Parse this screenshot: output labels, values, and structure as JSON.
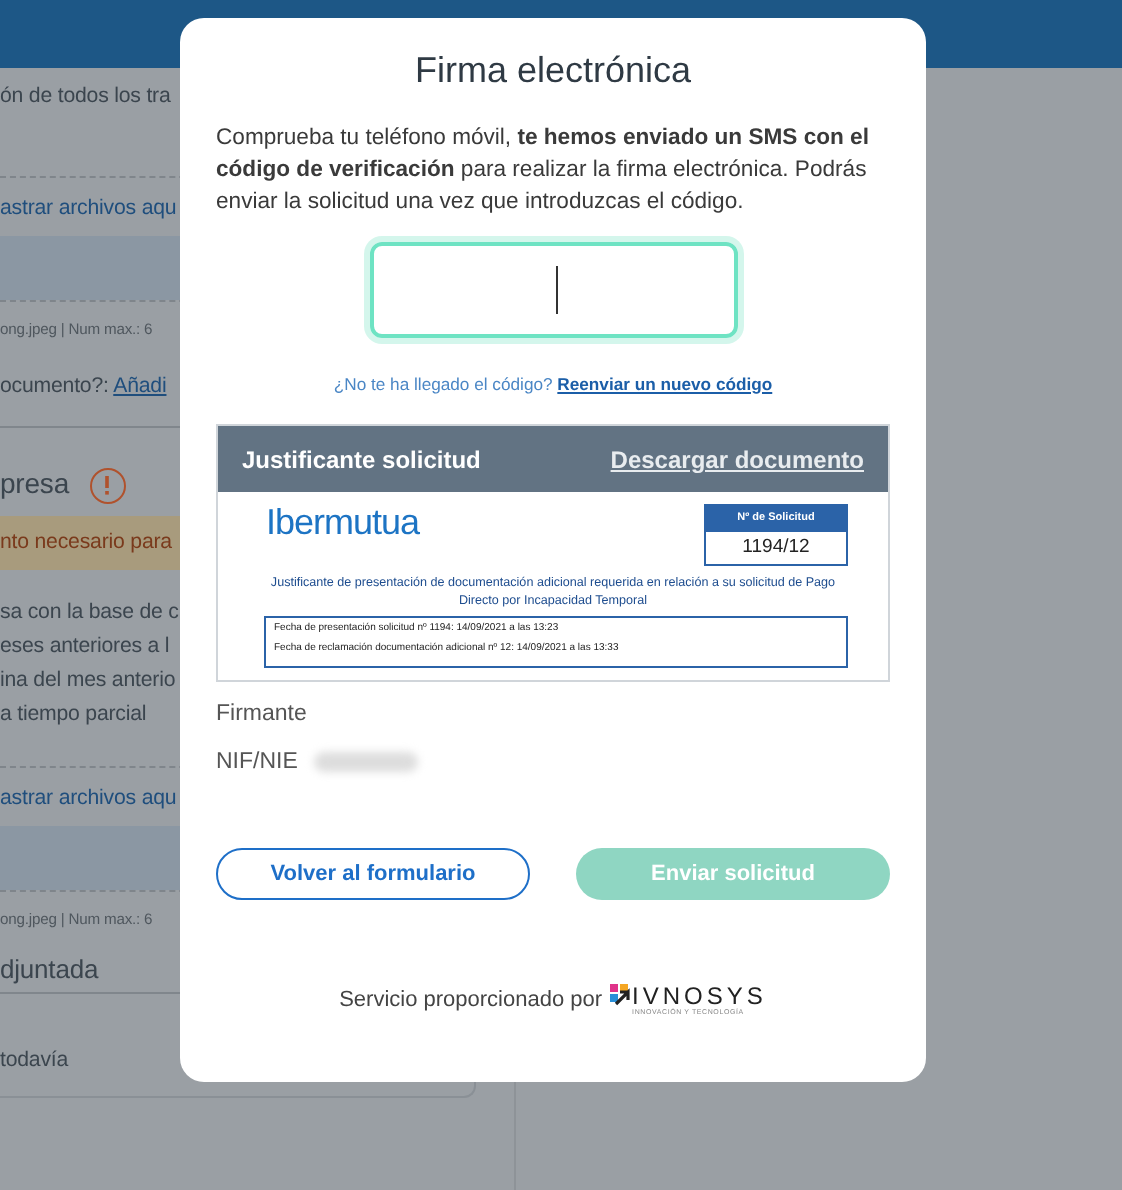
{
  "background": {
    "rows": [
      {
        "kind": "text",
        "text": "ón de todos los tra"
      },
      {
        "kind": "dropzone",
        "text": "astrar archivos aqu"
      },
      {
        "kind": "hint",
        "text": "ong.jpeg | Num max.: 6"
      },
      {
        "kind": "linkline",
        "text": "ocumento?: ",
        "link": "Añadi"
      },
      {
        "kind": "heading",
        "text": "presa"
      },
      {
        "kind": "warning",
        "text": "nto necesario para"
      },
      {
        "kind": "text",
        "text": "sa con la base de c"
      },
      {
        "kind": "text",
        "text": "eses anteriores a l"
      },
      {
        "kind": "text",
        "text": "ina del mes anterio"
      },
      {
        "kind": "text",
        "text": "a tiempo parcial"
      },
      {
        "kind": "dropzone",
        "text": "astrar archivos aqu"
      },
      {
        "kind": "hint",
        "text": "ong.jpeg | Num max.: 6"
      },
      {
        "kind": "subheading",
        "text": "djuntada"
      },
      {
        "kind": "box",
        "text": "todavía"
      }
    ]
  },
  "modal": {
    "title": "Firma electrónica",
    "intro": "Comprueba tu teléfono móvil, **te hemos enviado un SMS con el código de verificación** para realizar la firma electrónica. Podrás enviar la solicitud una vez que introduzcas el código.",
    "code_field": {
      "focused": true
    },
    "resend": {
      "prompt": "¿No te ha llegado el código?",
      "link": "Reenviar un nuevo código"
    },
    "document": {
      "title": "Justificante solicitud",
      "download": "Descargar documento",
      "logo": "Ibermutua",
      "number_label": "Nº de Solicitud",
      "number": "1194/12",
      "description": "Justificante de presentación de documentación adicional requerida en relación a su solicitud de Pago Directo por Incapacidad Temporal",
      "dates": [
        "Fecha de presentación solicitud nº 1194: 14/09/2021 a las 13:23",
        "Fecha de reclamación documentación adicional nº 12: 14/09/2021 a las 13:33"
      ]
    },
    "signer": {
      "label": "Firmante",
      "id_label": "NIF/NIE"
    },
    "buttons": [
      {
        "label": "Volver al formulario",
        "kind": "outline",
        "disabled": false
      },
      {
        "label": "Enviar solicitud",
        "kind": "primary",
        "disabled": true
      }
    ],
    "footer": {
      "text": "Servicio proporcionado por",
      "brand": "IVNOSYS",
      "tagline": "INNOVACIÓN Y TECNOLOGÍA"
    }
  }
}
